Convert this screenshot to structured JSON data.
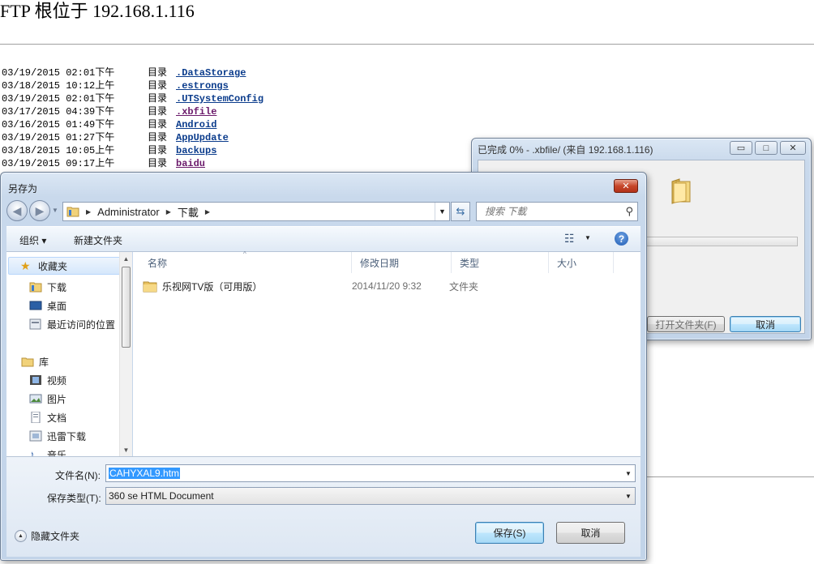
{
  "ftp": {
    "title": "FTP 根位于 192.168.1.116",
    "entries": [
      {
        "date": "03/19/2015 02:01下午",
        "kind": "目录",
        "name": ".DataStorage",
        "visited": false
      },
      {
        "date": "03/18/2015 10:12上午",
        "kind": "目录",
        "name": ".estrongs",
        "visited": false
      },
      {
        "date": "03/19/2015 02:01下午",
        "kind": "目录",
        "name": ".UTSystemConfig",
        "visited": false
      },
      {
        "date": "03/17/2015 04:39下午",
        "kind": "目录",
        "name": ".xbfile",
        "visited": true
      },
      {
        "date": "03/16/2015 01:49下午",
        "kind": "目录",
        "name": "Android",
        "visited": false
      },
      {
        "date": "03/19/2015 01:27下午",
        "kind": "目录",
        "name": "AppUpdate",
        "visited": false
      },
      {
        "date": "03/18/2015 10:05上午",
        "kind": "目录",
        "name": "backups",
        "visited": false
      },
      {
        "date": "03/19/2015 09:17上午",
        "kind": "目录",
        "name": "baidu",
        "visited": true
      }
    ]
  },
  "progress_window": {
    "title": "已完成 0% - .xbfile/ (来自 192.168.1.116)",
    "progress": 0,
    "open_folder_label": "打开文件夹(F)",
    "cancel_label": "取消"
  },
  "save_dialog": {
    "title": "另存为",
    "address": [
      "Administrator",
      "下載"
    ],
    "search_placeholder": "搜索 下載",
    "toolbar": {
      "organize": "组织 ▾",
      "new_folder": "新建文件夹"
    },
    "nav": {
      "favorites": "收藏夹",
      "items_fav": [
        "下载",
        "桌面",
        "最近访问的位置"
      ],
      "libraries": "库",
      "items_lib": [
        "视频",
        "图片",
        "文档",
        "迅雷下载",
        "音乐"
      ]
    },
    "columns": {
      "name": "名称",
      "date": "修改日期",
      "type": "类型",
      "size": "大小"
    },
    "files": [
      {
        "name": "乐视网TV版（可用版）",
        "date": "2014/11/20 9:32",
        "type": "文件夹"
      }
    ],
    "filename_label": "文件名(N):",
    "filename_value": "CAHYXAL9.htm",
    "filetype_label": "保存类型(T):",
    "filetype_value": "360 se HTML Document",
    "hide_folders_label": "隐藏文件夹",
    "save_label": "保存(S)",
    "cancel_label": "取消"
  },
  "colors": {
    "link": "#0b3c8c",
    "visited_link": "#6b1a6b",
    "selection": "#3399ff",
    "progress": "#4fc04f"
  }
}
